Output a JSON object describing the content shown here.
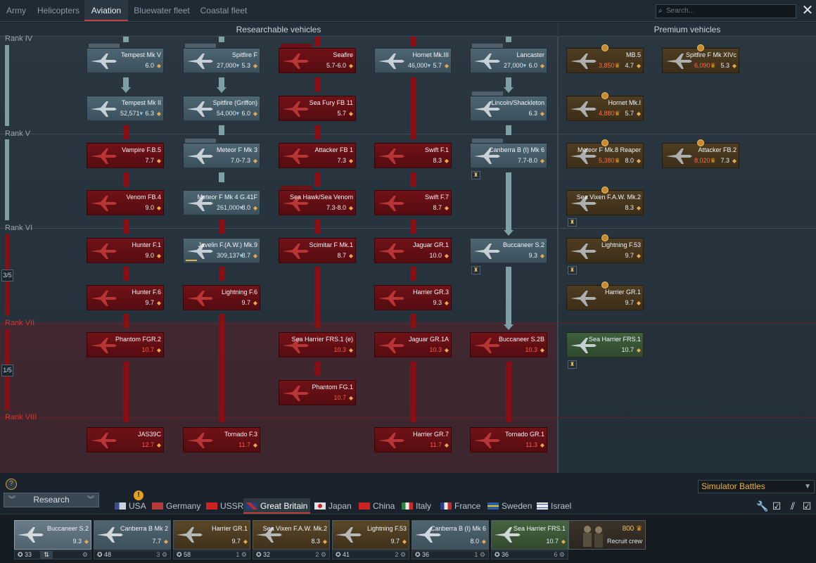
{
  "top_tabs": [
    {
      "label": "Army",
      "active": false
    },
    {
      "label": "Helicopters",
      "active": false
    },
    {
      "label": "Aviation",
      "active": true
    },
    {
      "label": "Bluewater fleet",
      "active": false
    },
    {
      "label": "Coastal fleet",
      "active": false
    }
  ],
  "search": {
    "placeholder": "Search..."
  },
  "close_label": "✕",
  "sections": {
    "researchable": "Researchable vehicles",
    "premium": "Premium vehicles"
  },
  "ranks": {
    "iv": "Rank IV",
    "v": "Rank V",
    "vi": "Rank VI",
    "vii": "Rank VII",
    "viii": "Rank VIII"
  },
  "fractions": {
    "vi": "3/5",
    "vii": "1/5"
  },
  "tree": {
    "tempest_v": {
      "name": "Tempest Mk V",
      "br": "6.0"
    },
    "spitfire_f": {
      "name": "Spitfire F",
      "rp": "27,000",
      "br": "5.3"
    },
    "seafire": {
      "name": "Seafire",
      "br": "5.7-6.0"
    },
    "hornet_3": {
      "name": "Hornet Mk.III",
      "rp": "46,000",
      "br": "5.7"
    },
    "lancaster": {
      "name": "Lancaster",
      "rp": "27,000",
      "br": "6.0"
    },
    "tempest_2": {
      "name": "Tempest Mk II",
      "rp": "52,571",
      "br": "6.3"
    },
    "spitfire_griffon": {
      "name": "Spitfire (Griffon)",
      "rp": "54,000",
      "br": "6.0"
    },
    "sea_fury": {
      "name": "Sea Fury FB 11",
      "br": "5.7"
    },
    "lincoln": {
      "name": "Lincoln/Shackleton",
      "br": "6.3"
    },
    "vampire": {
      "name": "Vampire F.B.5",
      "br": "7.7"
    },
    "meteor_3": {
      "name": "Meteor F Mk 3",
      "br": "7.0-7.3"
    },
    "attacker_fb1": {
      "name": "Attacker FB 1",
      "br": "7.3"
    },
    "swift_f1": {
      "name": "Swift F.1",
      "br": "8.3"
    },
    "canberra_b6": {
      "name": "Canberra B (I) Mk 6",
      "br": "7.7-8.0"
    },
    "venom": {
      "name": "Venom FB.4",
      "br": "9.0"
    },
    "meteor_4": {
      "name": "Meteor F Mk 4 G.41F",
      "rp": "261,000",
      "br": "8.0"
    },
    "sea_hawk": {
      "name": "Sea Hawk/Sea Venom",
      "br": "7.3-8.0"
    },
    "swift_f7": {
      "name": "Swift F.7",
      "br": "8.7"
    },
    "hunter_f1": {
      "name": "Hunter F.1",
      "br": "9.0"
    },
    "javelin": {
      "name": "Javelin F.(A.W.) Mk.9",
      "rp": "309,137",
      "br": "8.7"
    },
    "scimitar": {
      "name": "Scimitar F Mk.1",
      "br": "8.7"
    },
    "jaguar_gr1": {
      "name": "Jaguar GR.1",
      "br": "10.0"
    },
    "buccaneer_s2": {
      "name": "Buccaneer S.2",
      "br": "9.3"
    },
    "hunter_f6": {
      "name": "Hunter F.6",
      "br": "9.7"
    },
    "lightning_f6": {
      "name": "Lightning F.6",
      "br": "9.7"
    },
    "harrier_gr3": {
      "name": "Harrier GR.3",
      "br": "9.3"
    },
    "phantom_fgr2": {
      "name": "Phantom FGR.2",
      "br": "10.7"
    },
    "sea_harrier_e": {
      "name": "Sea Harrier FRS.1 (e)",
      "br": "10.3"
    },
    "jaguar_gr1a": {
      "name": "Jaguar GR.1A",
      "br": "10.3"
    },
    "buccaneer_s2b": {
      "name": "Buccaneer S.2B",
      "br": "10.3"
    },
    "phantom_fg1": {
      "name": "Phantom FG.1",
      "br": "10.7"
    },
    "jas39c": {
      "name": "JAS39C",
      "br": "12.7"
    },
    "tornado_f3": {
      "name": "Tornado F.3",
      "br": "11.7"
    },
    "harrier_gr7": {
      "name": "Harrier GR.7",
      "br": "11.7"
    },
    "tornado_gr1": {
      "name": "Tornado GR.1",
      "br": "11.3"
    }
  },
  "premium": {
    "mb5": {
      "name": "MB.5",
      "ge": "3,850",
      "br": "4.7"
    },
    "spitfire_xivc": {
      "name": "Spitfire F Mk XIVc",
      "ge": "6,090",
      "br": "5.3"
    },
    "hornet_1": {
      "name": "Hornet Mk.I",
      "ge": "4,880",
      "br": "5.7"
    },
    "meteor_8_reaper": {
      "name": "Meteor F Mk.8 Reaper",
      "ge": "5,380",
      "br": "8.0"
    },
    "attacker_fb2": {
      "name": "Attacker FB.2",
      "ge": "8,020",
      "br": "7.3"
    },
    "sea_vixen": {
      "name": "Sea Vixen F.A.W. Mk.2",
      "br": "8.3"
    },
    "lightning_f53": {
      "name": "Lightning F.53",
      "br": "9.7"
    },
    "harrier_gr1": {
      "name": "Harrier GR.1",
      "br": "9.7"
    },
    "sea_harrier_frs1": {
      "name": "Sea Harrier FRS.1",
      "br": "10.7"
    }
  },
  "mode_select": "Simulator Battles",
  "research_button": "Research",
  "nations": [
    {
      "label": "USA",
      "active": false
    },
    {
      "label": "Germany",
      "active": false
    },
    {
      "label": "USSR",
      "active": false
    },
    {
      "label": "Great Britain",
      "active": true
    },
    {
      "label": "Japan",
      "active": false
    },
    {
      "label": "China",
      "active": false
    },
    {
      "label": "Italy",
      "active": false
    },
    {
      "label": "France",
      "active": false
    },
    {
      "label": "Sweden",
      "active": false
    },
    {
      "label": "Israel",
      "active": false
    }
  ],
  "nation_alert": "!",
  "crew": [
    {
      "name": "Buccaneer S.2",
      "br": "9.3",
      "level": "33",
      "count": ""
    },
    {
      "name": "Canberra B Mk 2",
      "br": "7.7",
      "level": "48",
      "count": "3"
    },
    {
      "name": "Harrier GR.1",
      "br": "9.7",
      "level": "58",
      "count": "1"
    },
    {
      "name": "Sea Vixen F.A.W. Mk.2",
      "br": "8.3",
      "level": "32",
      "count": "2"
    },
    {
      "name": "Lightning F.53",
      "br": "9.7",
      "level": "41",
      "count": "2"
    },
    {
      "name": "Canberra B (I) Mk 6",
      "br": "8.0",
      "level": "36",
      "count": "1"
    },
    {
      "name": "Sea Harrier FRS.1",
      "br": "10.7",
      "level": "36",
      "count": "6"
    }
  ],
  "recruit": {
    "cost": "800",
    "label": "Recruit crew"
  },
  "icons": {
    "rank": "rank-diamond",
    "rp": "research-drop",
    "ge": "golden-eagle",
    "help": "help-icon"
  },
  "colors": {
    "red_tree": "#701218",
    "teal_tree": "#4e6673",
    "premium": "#4e3d22",
    "accent": "#c0413a",
    "simulator": "#e8b040"
  }
}
